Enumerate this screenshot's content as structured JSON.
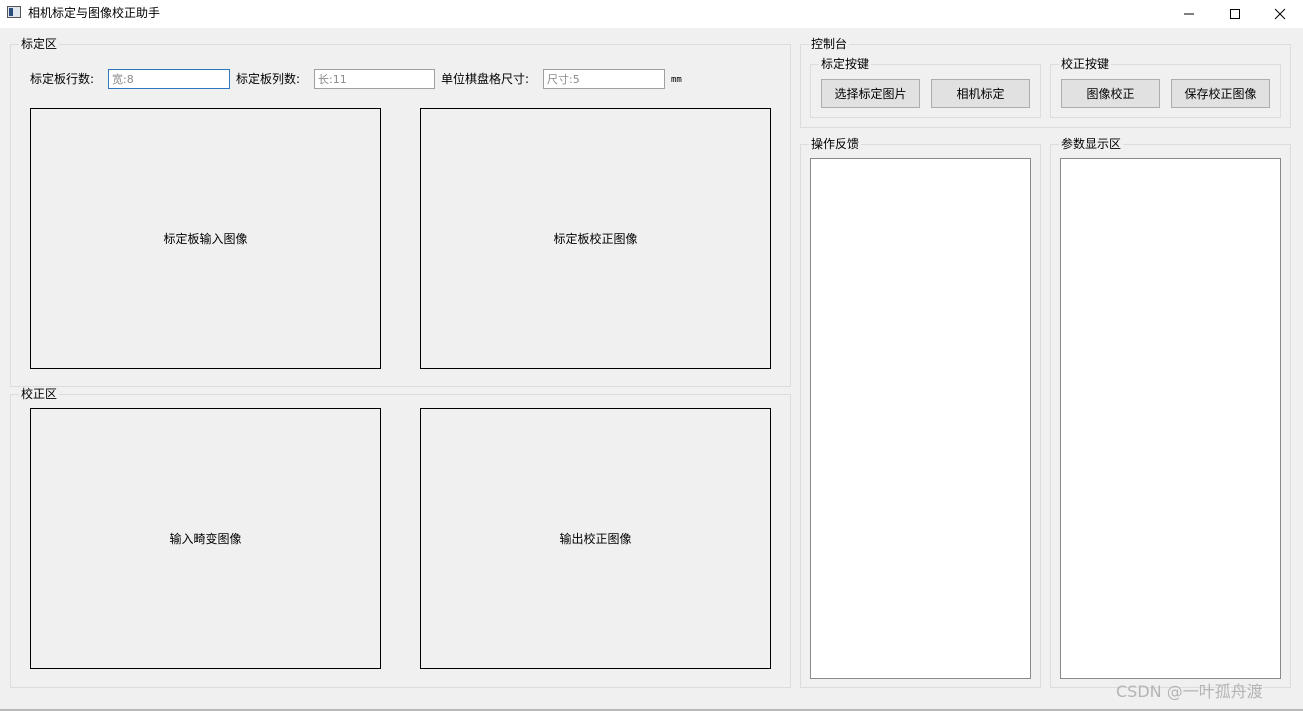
{
  "window": {
    "title": "相机标定与图像校正助手",
    "icon": "app-window-icon",
    "controls": [
      "minimize-icon",
      "maximize-icon",
      "close-icon"
    ]
  },
  "calibration_area": {
    "title": "标定区",
    "rows_label": "标定板行数:",
    "rows_placeholder": "宽:8",
    "cols_label": "标定板列数:",
    "cols_placeholder": "长:11",
    "square_label": "单位棋盘格尺寸:",
    "square_placeholder": "尺寸:5",
    "unit": "mm",
    "input_image_label": "标定板输入图像",
    "corrected_image_label": "标定板校正图像"
  },
  "correction_area": {
    "title": "校正区",
    "distorted_image_label": "输入畸变图像",
    "output_image_label": "输出校正图像"
  },
  "console": {
    "title": "控制台",
    "calibration_keys": {
      "title": "标定按键",
      "select_button": "选择标定图片",
      "calibrate_button": "相机标定"
    },
    "correction_keys": {
      "title": "校正按键",
      "correct_button": "图像校正",
      "save_button": "保存校正图像"
    }
  },
  "feedback": {
    "title": "操作反馈"
  },
  "params": {
    "title": "参数显示区"
  },
  "watermark": "CSDN @一叶孤舟渡",
  "colors": {
    "background": "#f0f0f0",
    "focus_border": "#2f76c0",
    "button_face": "#e1e1e1"
  }
}
